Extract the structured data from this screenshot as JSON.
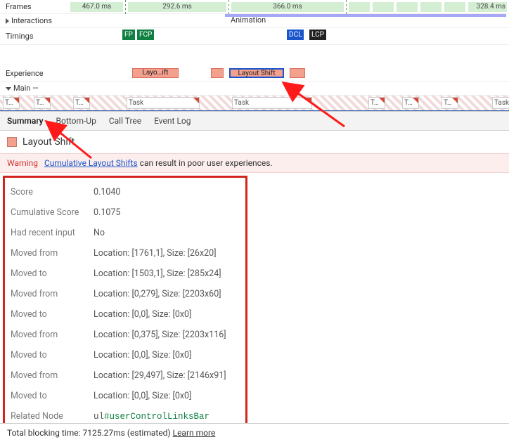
{
  "tracks": {
    "frames": {
      "label": "Frames",
      "blocks": [
        "467.0 ms",
        "292.6 ms",
        "366.0 ms",
        "328.4 ms"
      ]
    },
    "interactions": {
      "label": "Interactions",
      "animation": "Animation"
    },
    "timings": {
      "label": "Timings",
      "chips": [
        "FP",
        "FCP",
        "DCL",
        "LCP"
      ]
    },
    "experience": {
      "label": "Experience",
      "chips": [
        {
          "label": "Layo…ift",
          "selected": false
        },
        {
          "label": "Layout Shift",
          "selected": true
        }
      ]
    },
    "main": {
      "label": "Main",
      "dash": "—"
    },
    "tasks": [
      "T…",
      "T…",
      "T…",
      "Task",
      "Task",
      "T…",
      "T…",
      "T…",
      "Task"
    ]
  },
  "tabs": [
    "Summary",
    "Bottom-Up",
    "Call Tree",
    "Event Log"
  ],
  "active_tab": 0,
  "layout_shift_title": "Layout Shift",
  "warning": {
    "label": "Warning",
    "link_text": "Cumulative Layout Shifts",
    "rest": " can result in poor user experiences."
  },
  "details": [
    {
      "k": "Score",
      "v": "0.1040"
    },
    {
      "k": "Cumulative Score",
      "v": "0.1075"
    },
    {
      "k": "Had recent input",
      "v": "No"
    },
    {
      "k": "Moved from",
      "v": "Location: [1761,1], Size: [26x20]"
    },
    {
      "k": "Moved to",
      "v": "Location: [1503,1], Size: [285x24]"
    },
    {
      "k": "Moved from",
      "v": "Location: [0,279], Size: [2203x60]"
    },
    {
      "k": "Moved to",
      "v": "Location: [0,0], Size: [0x0]"
    },
    {
      "k": "Moved from",
      "v": "Location: [0,375], Size: [2203x116]"
    },
    {
      "k": "Moved to",
      "v": "Location: [0,0], Size: [0x0]"
    },
    {
      "k": "Moved from",
      "v": "Location: [29,497], Size: [2146x91]"
    },
    {
      "k": "Moved to",
      "v": "Location: [0,0], Size: [0x0]"
    }
  ],
  "related_node": {
    "k": "Related Node",
    "tag": "ul",
    "sel": "#userControlLinksBar"
  },
  "footer": {
    "text": "Total blocking time: 7125.27ms (estimated) ",
    "link": "Learn more"
  }
}
